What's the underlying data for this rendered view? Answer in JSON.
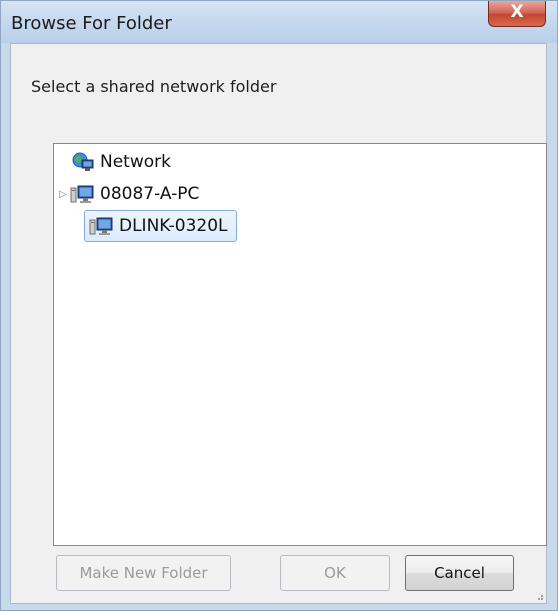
{
  "window": {
    "title": "Browse For Folder",
    "close_label": "X"
  },
  "instruction": "Select a shared network folder",
  "tree": {
    "root": {
      "label": "Network",
      "icon": "network-icon"
    },
    "items": [
      {
        "label": "08087-A-PC",
        "icon": "computer-icon",
        "expandable": true,
        "selected": false
      },
      {
        "label": "DLINK-0320L",
        "icon": "computer-icon",
        "expandable": false,
        "selected": true
      }
    ]
  },
  "buttons": {
    "make_new_folder": "Make New Folder",
    "ok": "OK",
    "cancel": "Cancel"
  },
  "colors": {
    "selection_border": "#84acdd",
    "close_button": "#c24733",
    "titlebar": "#c3d6ee"
  }
}
